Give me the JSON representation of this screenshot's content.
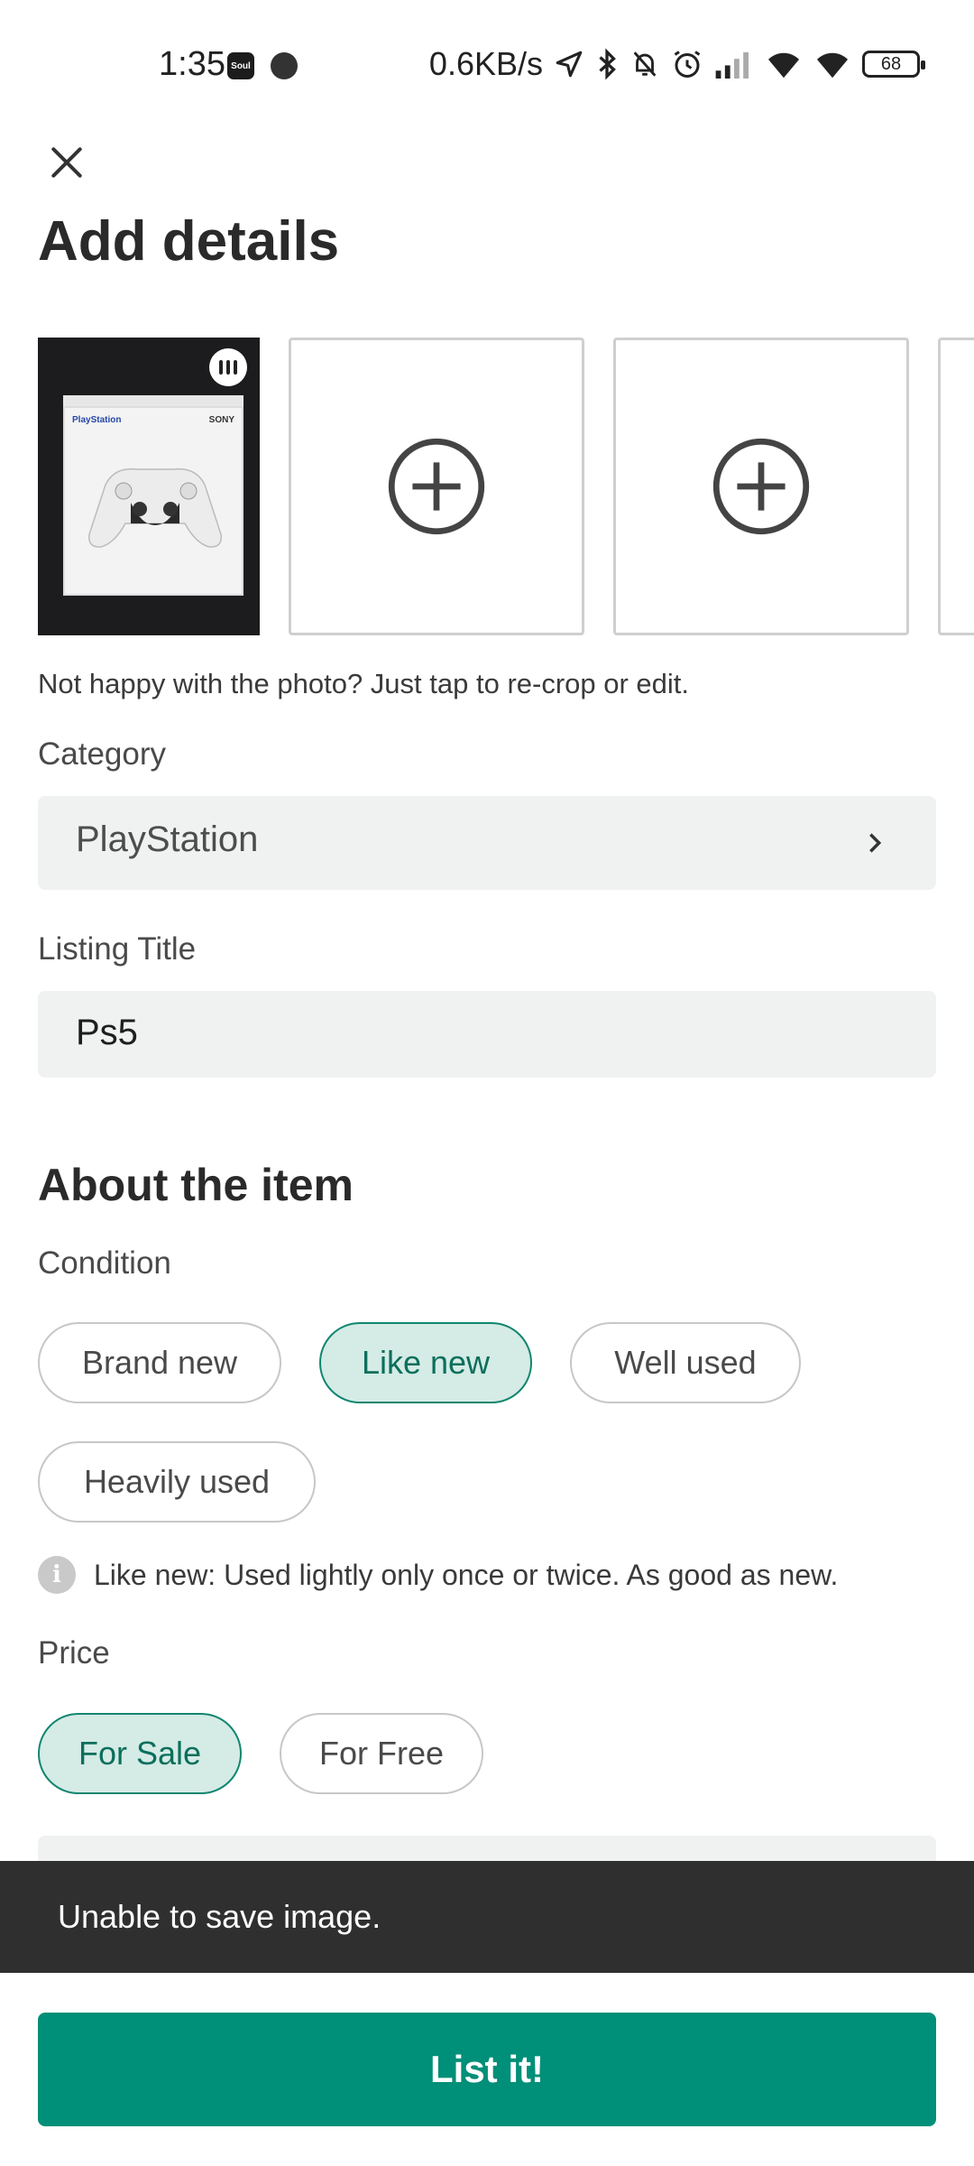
{
  "status_bar": {
    "time": "1:35",
    "app_badge": "Soul",
    "net_speed": "0.6KB/s",
    "battery": "68",
    "icons": [
      "location-icon",
      "bluetooth-icon",
      "mute-icon",
      "alarm-icon",
      "signal-icon",
      "wifi-icon",
      "wifi-icon"
    ]
  },
  "header": {
    "close_icon": "close-icon",
    "title": "Add details"
  },
  "photos": {
    "hint": "Not happy with the photo? Just tap to re-crop or edit.",
    "main_photo": {
      "brand": "PlayStation",
      "maker": "SONY"
    },
    "add_icon": "add-circle-icon"
  },
  "category": {
    "label": "Category",
    "value": "PlayStation"
  },
  "listing_title": {
    "label": "Listing Title",
    "value": "Ps5"
  },
  "about": {
    "title": "About the item",
    "condition_label": "Condition",
    "conditions": [
      "Brand new",
      "Like new",
      "Well used",
      "Heavily used"
    ],
    "selected_condition": "Like new",
    "condition_info": "Like new: Used lightly only once or twice. As good as new."
  },
  "price": {
    "label": "Price",
    "options": [
      "For Sale",
      "For Free"
    ],
    "selected": "For Sale"
  },
  "snackbar": {
    "message": "Unable to save image."
  },
  "submit": {
    "label": "List it!"
  },
  "colors": {
    "accent": "#008f78",
    "chip_active_bg": "#d5ebe6",
    "field_bg": "#f0f1f1",
    "snackbar_bg": "#2f2f2f"
  }
}
